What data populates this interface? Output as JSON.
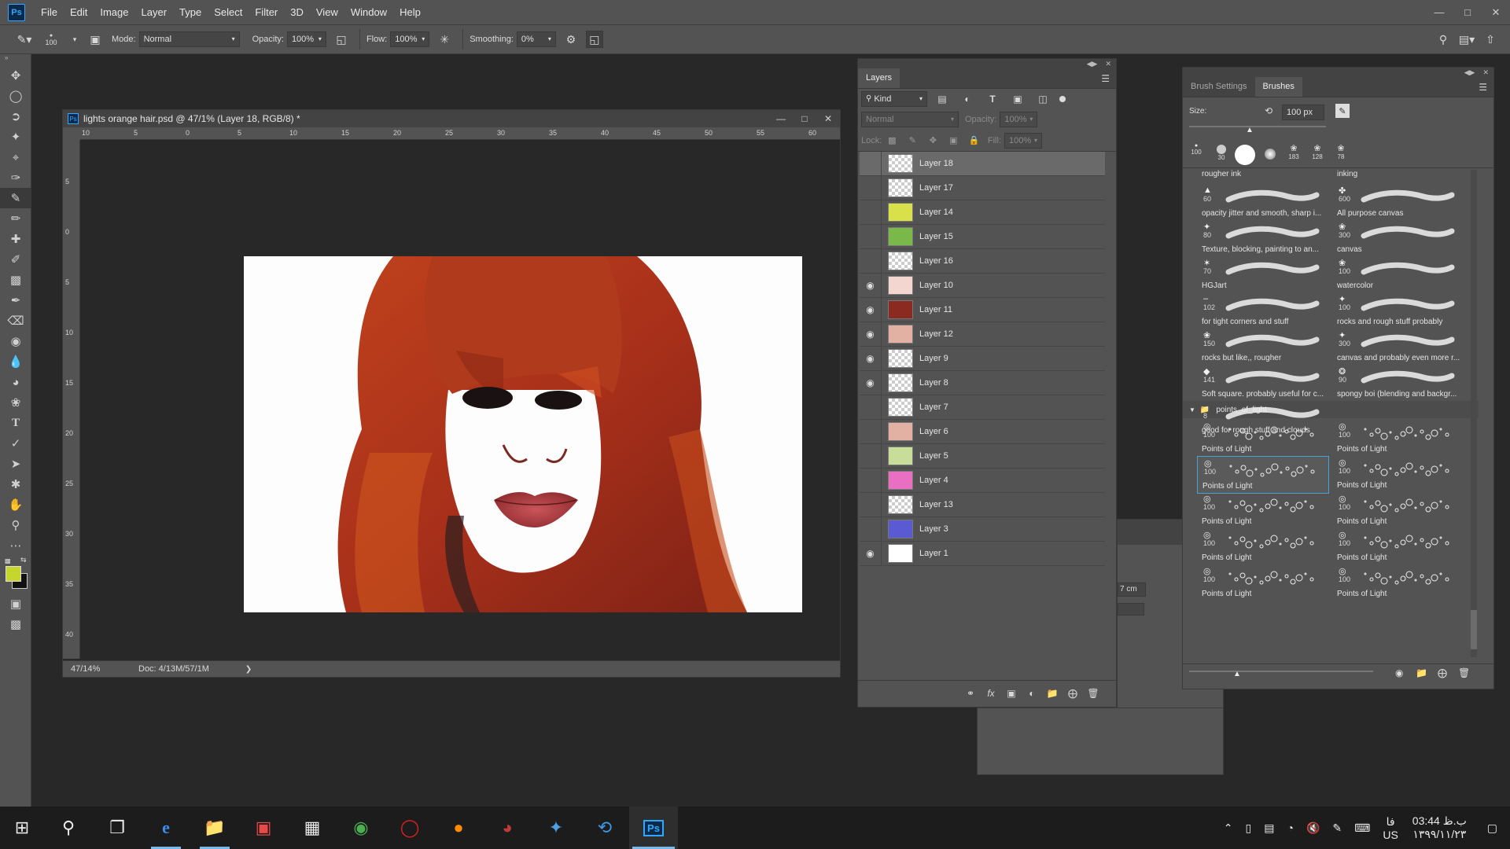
{
  "menubar": {
    "logo": "Ps",
    "items": [
      "File",
      "Edit",
      "Image",
      "Layer",
      "Type",
      "Select",
      "Filter",
      "3D",
      "View",
      "Window",
      "Help"
    ]
  },
  "options": {
    "brush_size": "100",
    "mode_label": "Mode:",
    "mode_value": "Normal",
    "opacity_label": "Opacity:",
    "opacity_value": "100%",
    "flow_label": "Flow:",
    "flow_value": "100%",
    "smoothing_label": "Smoothing:",
    "smoothing_value": "0%"
  },
  "document": {
    "title": "lights orange hair.psd @ 47/1% (Layer 18, RGB/8) *",
    "zoom": "47/14%",
    "doc_info": "Doc: 4/13M/57/1M",
    "ruler_h": [
      "10",
      "5",
      "0",
      "5",
      "10",
      "15",
      "20",
      "25",
      "30",
      "35",
      "40",
      "45",
      "50",
      "55",
      "60"
    ],
    "ruler_v": [
      "5",
      "0",
      "5",
      "10",
      "15",
      "20",
      "25",
      "30",
      "35",
      "40"
    ]
  },
  "layers_panel": {
    "tab": "Layers",
    "kind_label": "Kind",
    "blend_mode": "Normal",
    "opacity_label": "Opacity:",
    "opacity_value": "100%",
    "lock_label": "Lock:",
    "fill_label": "Fill:",
    "fill_value": "100%",
    "layers": [
      {
        "name": "Layer 18",
        "visible": false,
        "selected": true,
        "thumb": "checker"
      },
      {
        "name": "Layer 17",
        "visible": false,
        "thumb": "checker"
      },
      {
        "name": "Layer 14",
        "visible": false,
        "thumb": "yellow"
      },
      {
        "name": "Layer 15",
        "visible": false,
        "thumb": "green"
      },
      {
        "name": "Layer 16",
        "visible": false,
        "thumb": "checker"
      },
      {
        "name": "Layer 10",
        "visible": true,
        "thumb": "red-light"
      },
      {
        "name": "Layer 11",
        "visible": true,
        "thumb": "red-dark"
      },
      {
        "name": "Layer 12",
        "visible": true,
        "thumb": "red-mid"
      },
      {
        "name": "Layer 9",
        "visible": true,
        "thumb": "checker"
      },
      {
        "name": "Layer 8",
        "visible": true,
        "thumb": "checker-red"
      },
      {
        "name": "Layer 7",
        "visible": false,
        "thumb": "checker-red"
      },
      {
        "name": "Layer 6",
        "visible": false,
        "thumb": "red-mid"
      },
      {
        "name": "Layer 5",
        "visible": false,
        "thumb": "green-light"
      },
      {
        "name": "Layer 4",
        "visible": false,
        "thumb": "pink"
      },
      {
        "name": "Layer 13",
        "visible": false,
        "thumb": "checker"
      },
      {
        "name": "Layer 3",
        "visible": false,
        "thumb": "blue"
      },
      {
        "name": "Layer 1",
        "visible": true,
        "thumb": "white"
      }
    ]
  },
  "brushes_panel": {
    "tabs": [
      "Brush Settings",
      "Brushes"
    ],
    "size_label": "Size:",
    "size_value": "100 px",
    "recent_sizes": [
      "100",
      "30",
      "",
      "",
      "183",
      "128",
      "78"
    ],
    "partial_row": [
      "rougher ink",
      "inking"
    ],
    "brushes": [
      {
        "size": "60",
        "name": "opacity jitter and smooth, sharp i..."
      },
      {
        "size": "600",
        "name": "All purpose canvas"
      },
      {
        "size": "80",
        "name": "Texture, blocking, painting to an..."
      },
      {
        "size": "300",
        "name": "canvas"
      },
      {
        "size": "70",
        "name": "HGJart"
      },
      {
        "size": "100",
        "name": "watercolor"
      },
      {
        "size": "102",
        "name": "for tight corners and stuff"
      },
      {
        "size": "100",
        "name": "rocks and rough stuff probably"
      },
      {
        "size": "150",
        "name": "rocks but like,, rougher"
      },
      {
        "size": "300",
        "name": "canvas and probably even more r..."
      },
      {
        "size": "141",
        "name": "Soft square. probably useful for c..."
      },
      {
        "size": "90",
        "name": "spongy boi (blending and backgr..."
      },
      {
        "size": "8",
        "name": "good for rough stuff and clouds"
      }
    ],
    "group_name": "points_of_light",
    "group_brushes": [
      {
        "size": "100",
        "name": "Points of Light"
      },
      {
        "size": "100",
        "name": "Points of Light"
      },
      {
        "size": "100",
        "name": "Points of Light"
      },
      {
        "size": "100",
        "name": "Points of Light"
      },
      {
        "size": "100",
        "name": "Points of Light"
      },
      {
        "size": "100",
        "name": "Points of Light"
      },
      {
        "size": "100",
        "name": "Points of Light"
      },
      {
        "size": "100",
        "name": "Points of Light"
      },
      {
        "size": "100",
        "name": "Points of Light"
      },
      {
        "size": "100",
        "name": "Points of Light"
      }
    ]
  },
  "background_panel": {
    "field_value": "7 cm"
  },
  "taskbar": {
    "clock_time": "03:44 ب.ظ",
    "clock_date": "۱۳۹۹/۱۱/۲۳",
    "lang_top": "فا",
    "lang_bottom": "US"
  },
  "colors": {
    "foreground": "#c6d62c",
    "background": "#111111",
    "accent": "#31a8ff"
  }
}
